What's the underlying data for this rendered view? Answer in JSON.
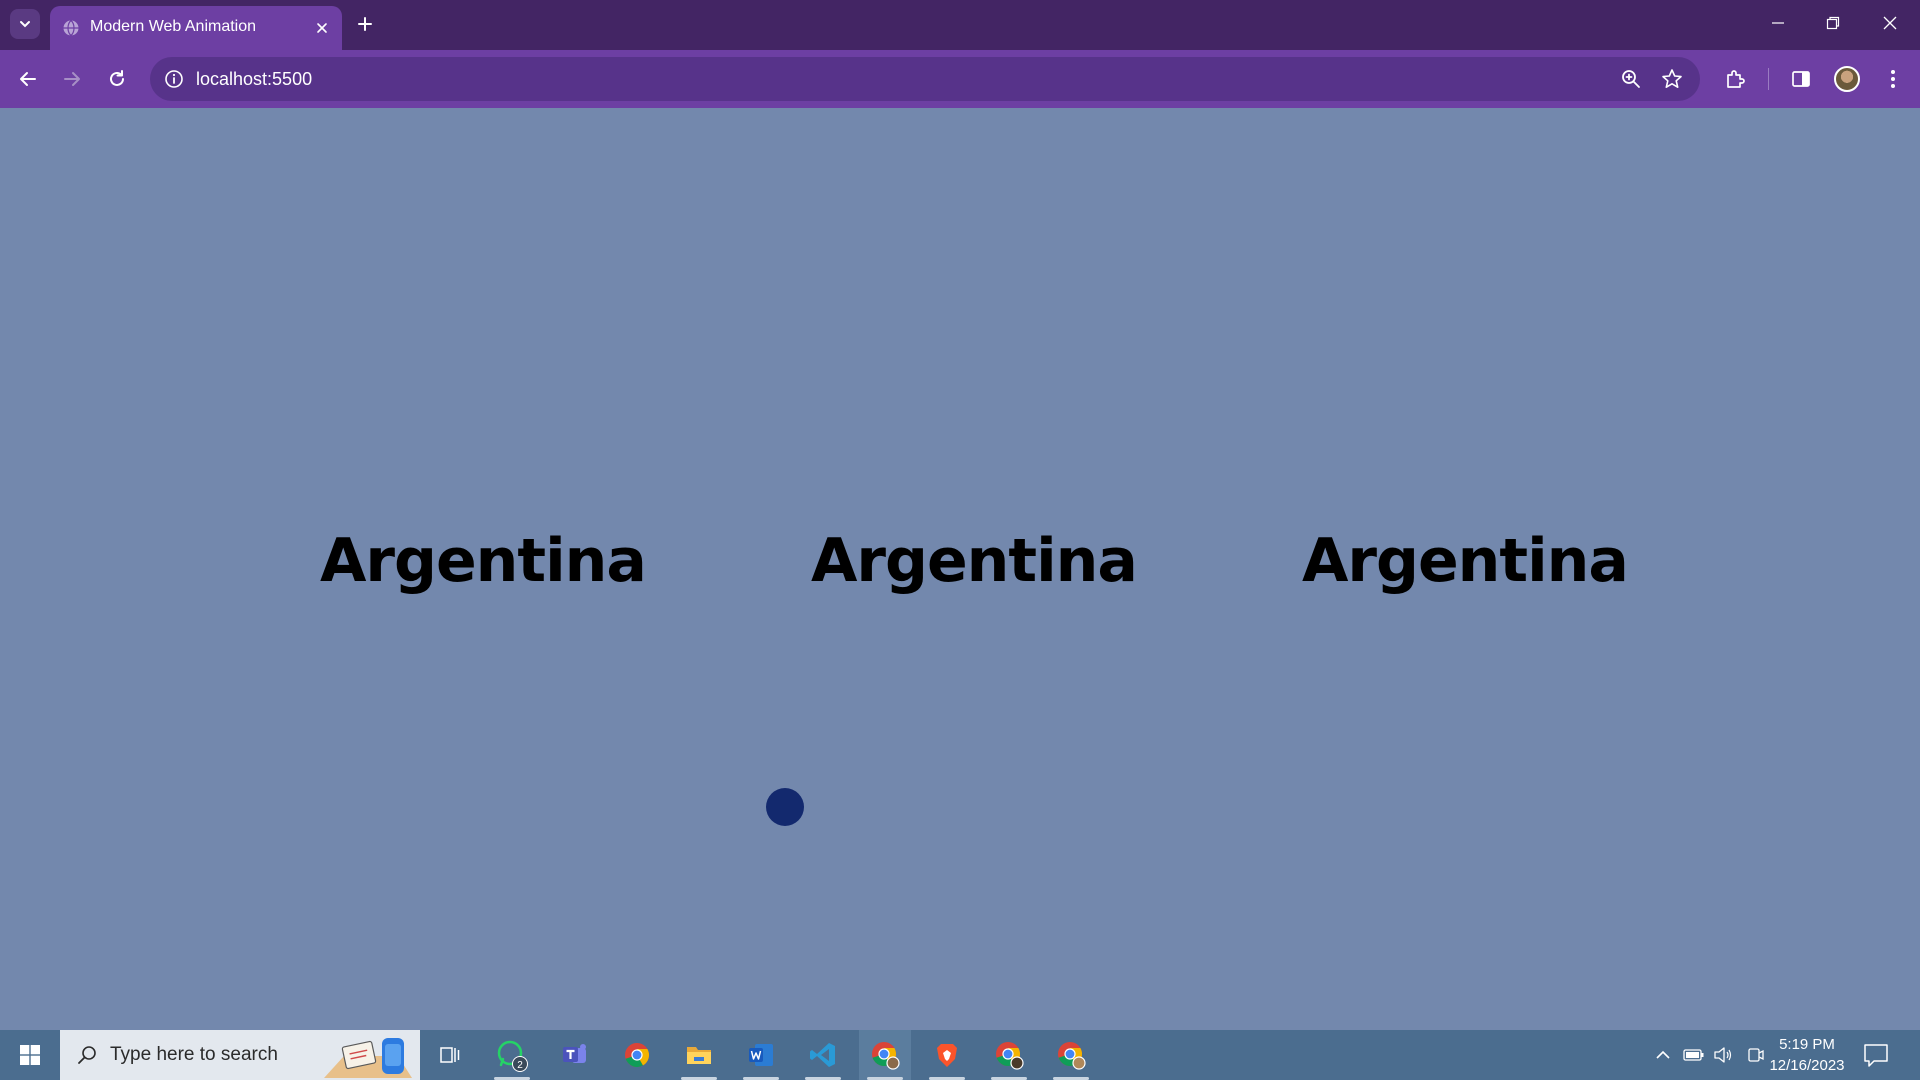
{
  "browser": {
    "tab_title": "Modern Web Animation",
    "url": "localhost:5500"
  },
  "page": {
    "words": [
      "Argentina",
      "Argentina",
      "Argentina"
    ]
  },
  "taskbar": {
    "search_placeholder": "Type here to search",
    "whatsapp_badge": "2",
    "clock_time": "5:19 PM",
    "clock_date": "12/16/2023"
  },
  "colors": {
    "page_background": "#7388ad",
    "titlebar": "#432564",
    "toolbar": "#6d3fa3",
    "dot": "#13296e",
    "taskbar": "#4b6d8f"
  }
}
